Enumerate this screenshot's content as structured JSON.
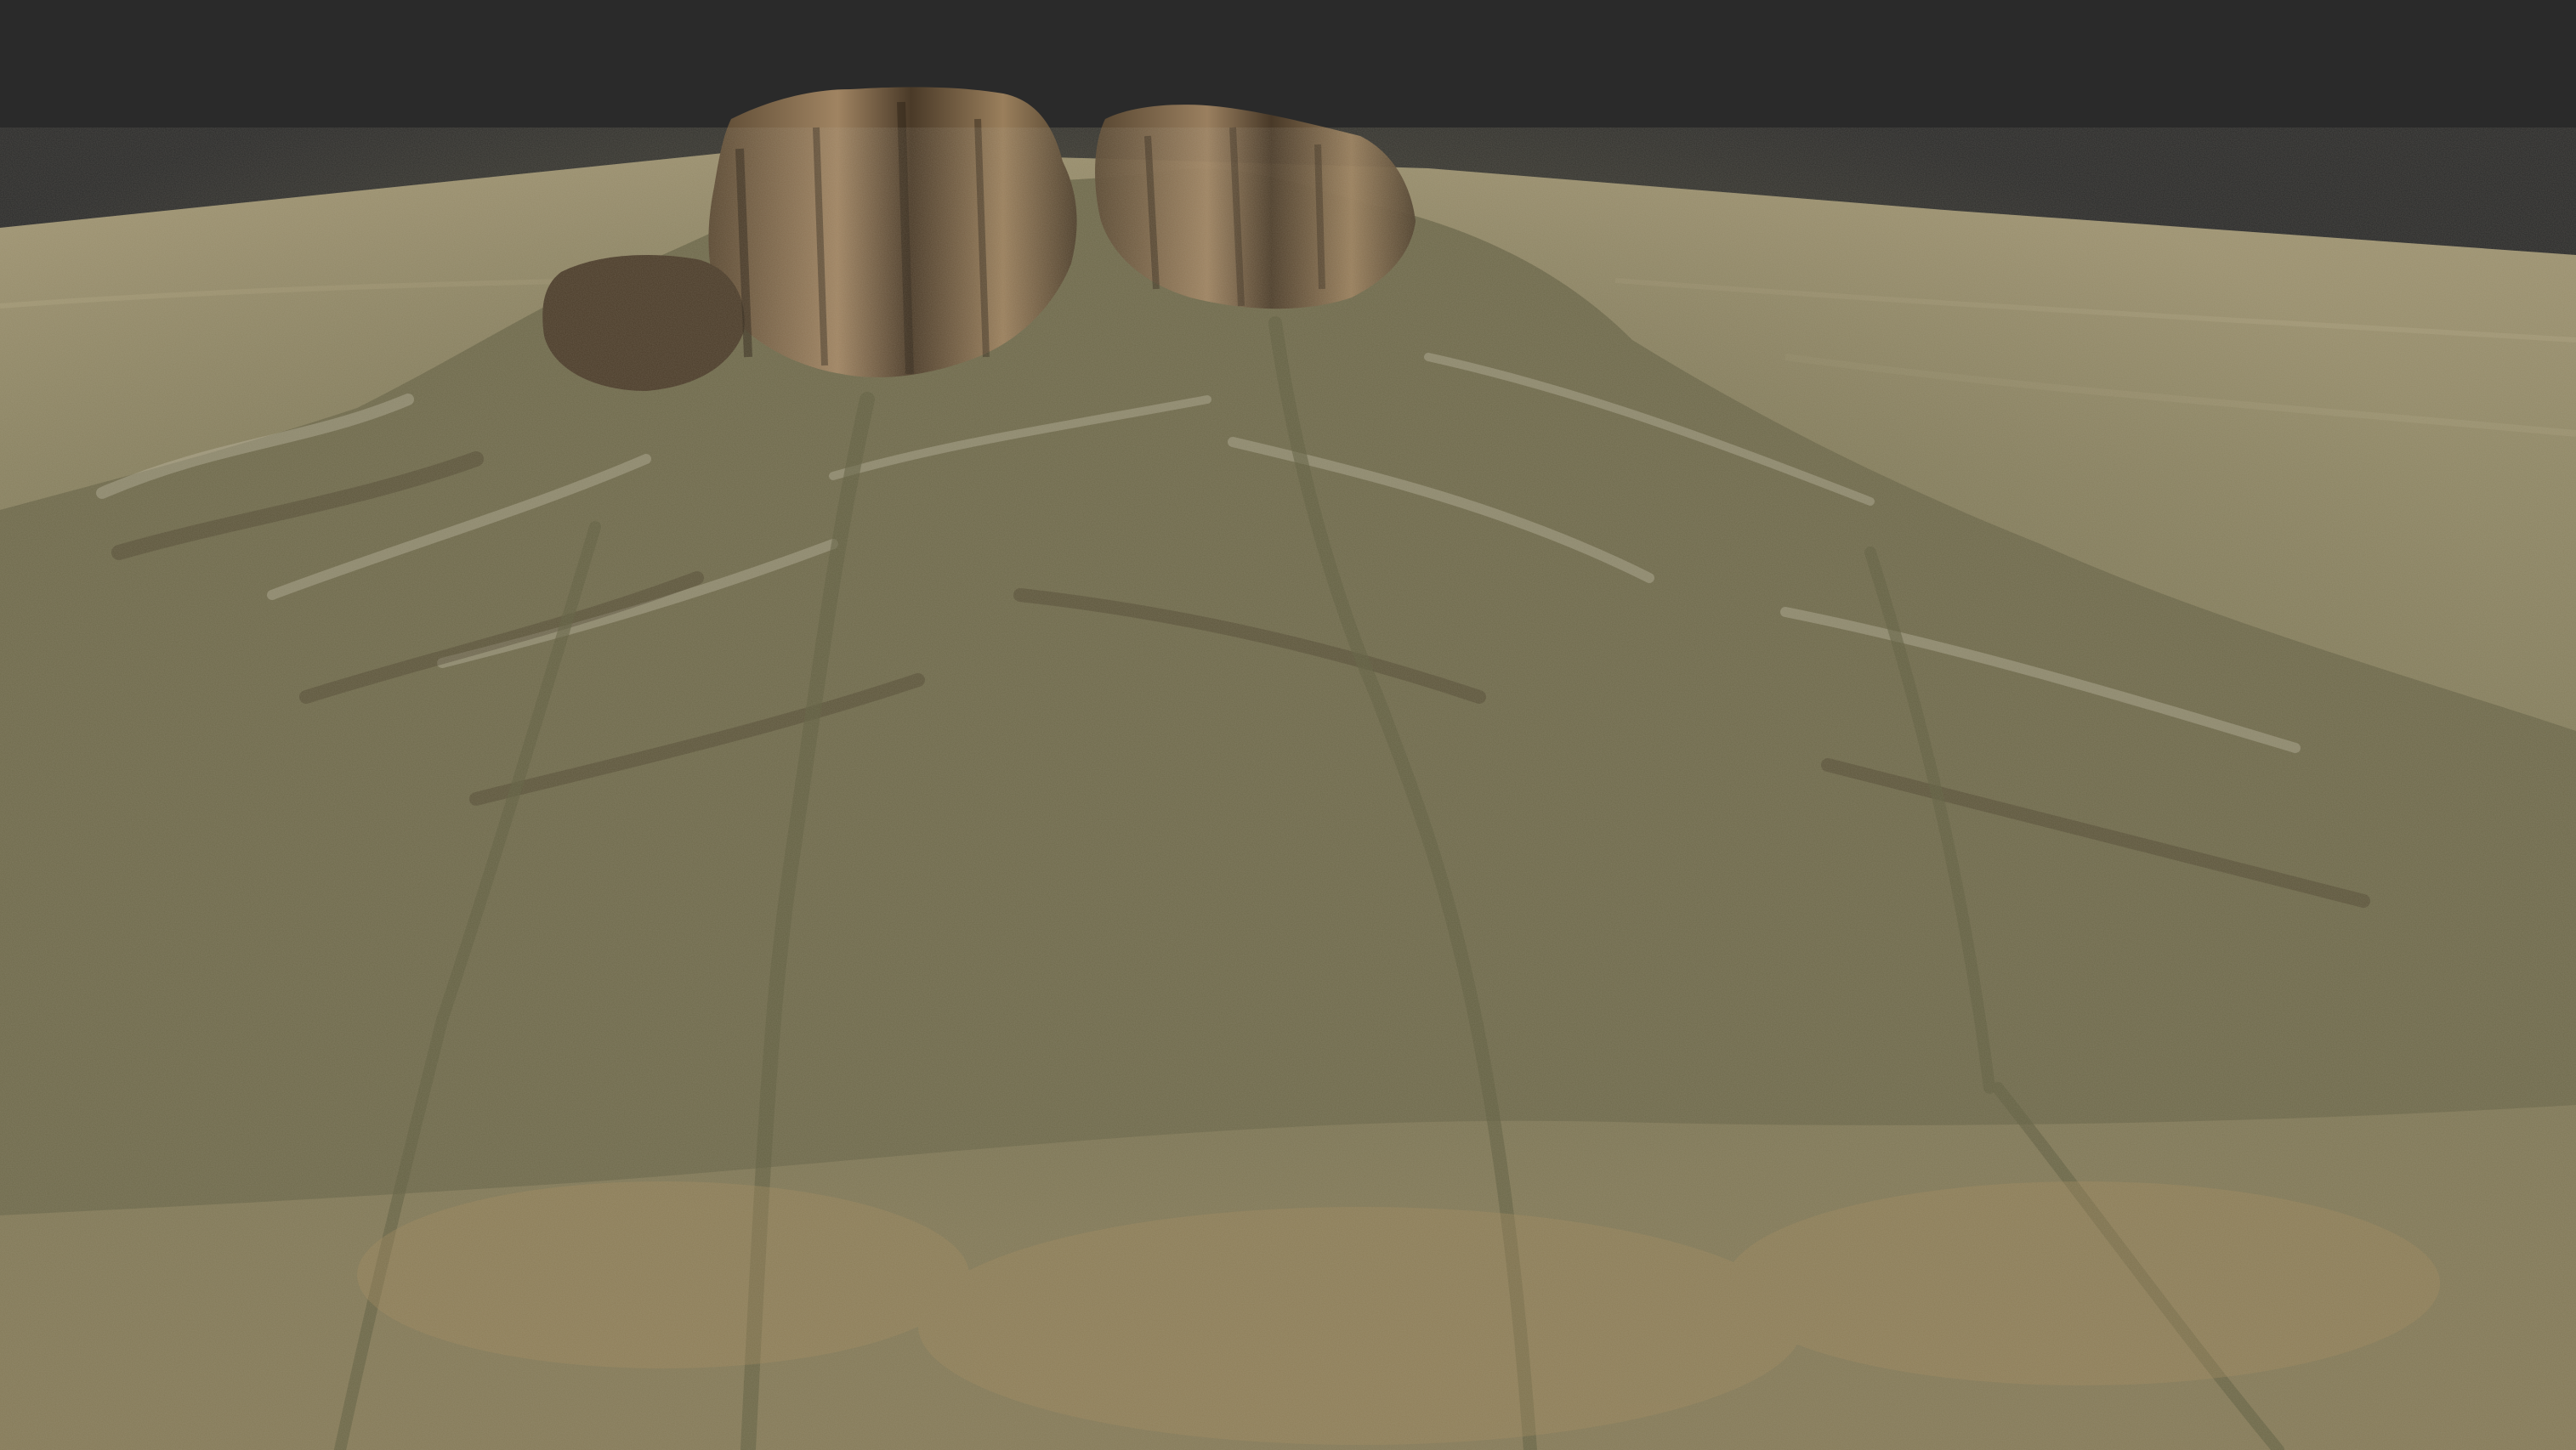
{
  "scene": {
    "kind": "3d-terrain-render",
    "features": [
      "sky-backdrop",
      "desert-plain",
      "mesa-butte",
      "ridge-range",
      "drainage-channels"
    ]
  },
  "colors": {
    "sky": "#2a2a2a",
    "plain_far": "#9e9270",
    "plain_mid": "#8c8462",
    "plain_near": "#8a805e",
    "terrain_base": "#7d7656",
    "ridge_light": "#b9b4a3",
    "ridge_shadow": "#4a3f2c",
    "mesa_top": "#8a6e4f",
    "mesa_face_dark": "#3f3222",
    "mesa_face_light": "#a48a66",
    "channel": "#6f6c4a",
    "sand_patch": "#a38a5c"
  }
}
